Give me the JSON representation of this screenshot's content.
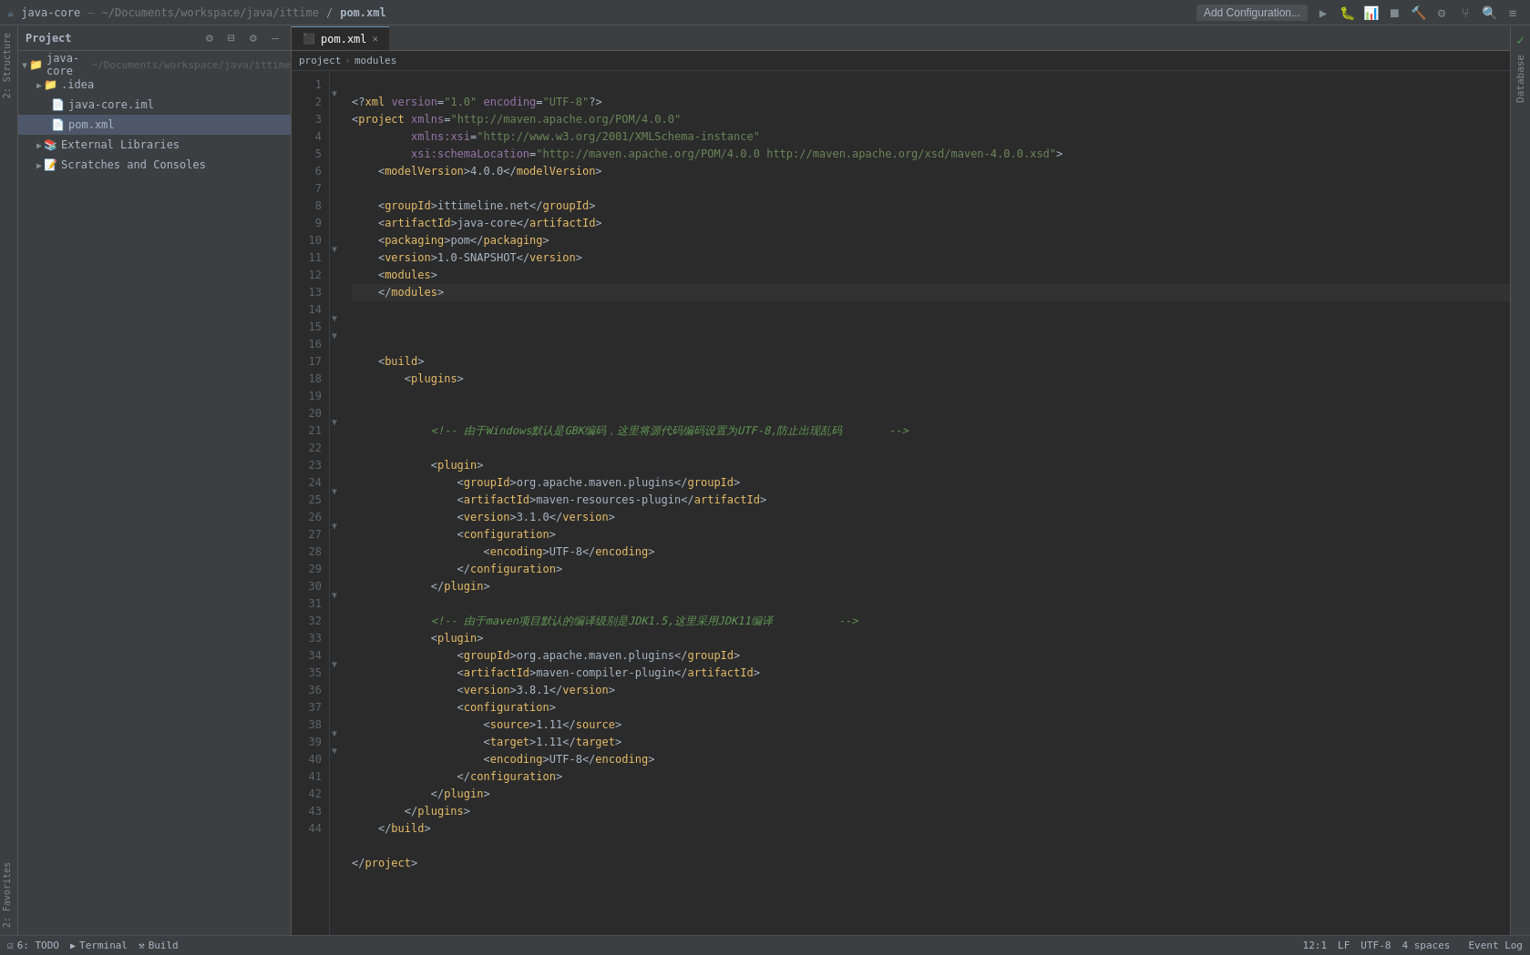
{
  "titleBar": {
    "projectLabel": "java-core",
    "pathLabel": "~/Documents/workspace/java/ittime",
    "fileLabel": "pom.xml",
    "addConfigLabel": "Add Configuration...",
    "separator": "▶"
  },
  "toolbar": {
    "icons": [
      "⚙",
      "⊟",
      "⚙",
      "–"
    ]
  },
  "projectPanel": {
    "title": "Project",
    "items": [
      {
        "label": "java-core",
        "type": "root",
        "indent": 0,
        "expanded": true
      },
      {
        "label": ".idea",
        "type": "folder",
        "indent": 1,
        "expanded": false
      },
      {
        "label": "java-core.iml",
        "type": "iml",
        "indent": 2,
        "expanded": false
      },
      {
        "label": "pom.xml",
        "type": "xml",
        "indent": 2,
        "expanded": false
      },
      {
        "label": "External Libraries",
        "type": "ext",
        "indent": 1,
        "expanded": false
      },
      {
        "label": "Scratches and Consoles",
        "type": "scratches",
        "indent": 1,
        "expanded": false
      }
    ]
  },
  "editorTabs": [
    {
      "label": "pom.xml",
      "active": true,
      "modified": false
    }
  ],
  "breadcrumb": {
    "items": [
      "project",
      "modules"
    ]
  },
  "codeLines": [
    {
      "num": 1,
      "content": "<?xml version=\"1.0\" encoding=\"UTF-8\"?>",
      "type": "xml-decl"
    },
    {
      "num": 2,
      "content": "<project xmlns=\"http://maven.apache.org/POM/4.0.0\"",
      "type": "xml"
    },
    {
      "num": 3,
      "content": "         xmlns:xsi=\"http://www.w3.org/2001/XMLSchema-instance\"",
      "type": "xml"
    },
    {
      "num": 4,
      "content": "         xsi:schemaLocation=\"http://maven.apache.org/POM/4.0.0 http://maven.apache.org/xsd/maven-4.0.0.xsd\">",
      "type": "xml"
    },
    {
      "num": 5,
      "content": "    <modelVersion>4.0.0</modelVersion>",
      "type": "xml"
    },
    {
      "num": 6,
      "content": "",
      "type": "empty"
    },
    {
      "num": 7,
      "content": "    <groupId>ittimeline.net</groupId>",
      "type": "xml"
    },
    {
      "num": 8,
      "content": "    <artifactId>java-core</artifactId>",
      "type": "xml"
    },
    {
      "num": 9,
      "content": "    <packaging>pom</packaging>",
      "type": "xml"
    },
    {
      "num": 10,
      "content": "    <version>1.0-SNAPSHOT</version>",
      "type": "xml"
    },
    {
      "num": 11,
      "content": "    <modules>",
      "type": "xml"
    },
    {
      "num": 12,
      "content": "    </modules>",
      "type": "xml",
      "current": true
    },
    {
      "num": 13,
      "content": "",
      "type": "empty"
    },
    {
      "num": 14,
      "content": "",
      "type": "empty"
    },
    {
      "num": 15,
      "content": "    <build>",
      "type": "xml"
    },
    {
      "num": 16,
      "content": "        <plugins>",
      "type": "xml"
    },
    {
      "num": 17,
      "content": "",
      "type": "empty"
    },
    {
      "num": 18,
      "content": "",
      "type": "empty"
    },
    {
      "num": 19,
      "content": "            <!-- 由于Windows默认是GBK编码，这里将源代码编码设置为UTF-8,防止出现乱码       -->",
      "type": "comment"
    },
    {
      "num": 20,
      "content": "",
      "type": "empty"
    },
    {
      "num": 21,
      "content": "            <plugin>",
      "type": "xml"
    },
    {
      "num": 22,
      "content": "                <groupId>org.apache.maven.plugins</groupId>",
      "type": "xml"
    },
    {
      "num": 23,
      "content": "                <artifactId>maven-resources-plugin</artifactId>",
      "type": "xml"
    },
    {
      "num": 24,
      "content": "                <version>3.1.0</version>",
      "type": "xml"
    },
    {
      "num": 25,
      "content": "                <configuration>",
      "type": "xml"
    },
    {
      "num": 26,
      "content": "                    <encoding>UTF-8</encoding>",
      "type": "xml"
    },
    {
      "num": 27,
      "content": "                </configuration>",
      "type": "xml"
    },
    {
      "num": 28,
      "content": "            </plugin>",
      "type": "xml"
    },
    {
      "num": 29,
      "content": "",
      "type": "empty"
    },
    {
      "num": 30,
      "content": "            <!-- 由于maven项目默认的编译级别是JDK1.5,这里采用JDK11编译          -->",
      "type": "comment"
    },
    {
      "num": 31,
      "content": "            <plugin>",
      "type": "xml"
    },
    {
      "num": 32,
      "content": "                <groupId>org.apache.maven.plugins</groupId>",
      "type": "xml"
    },
    {
      "num": 33,
      "content": "                <artifactId>maven-compiler-plugin</artifactId>",
      "type": "xml"
    },
    {
      "num": 34,
      "content": "                <version>3.8.1</version>",
      "type": "xml"
    },
    {
      "num": 35,
      "content": "                <configuration>",
      "type": "xml"
    },
    {
      "num": 36,
      "content": "                    <source>1.11</source>",
      "type": "xml"
    },
    {
      "num": 37,
      "content": "                    <target>1.11</target>",
      "type": "xml"
    },
    {
      "num": 38,
      "content": "                    <encoding>UTF-8</encoding>",
      "type": "xml"
    },
    {
      "num": 39,
      "content": "                </configuration>",
      "type": "xml"
    },
    {
      "num": 40,
      "content": "            </plugin>",
      "type": "xml"
    },
    {
      "num": 41,
      "content": "        </plugins>",
      "type": "xml"
    },
    {
      "num": 42,
      "content": "    </build>",
      "type": "xml"
    },
    {
      "num": 43,
      "content": "",
      "type": "empty"
    },
    {
      "num": 44,
      "content": "</project>",
      "type": "xml"
    }
  ],
  "statusBar": {
    "position": "12:1",
    "encoding": "UTF-8",
    "lineSep": "LF",
    "indent": "4 spaces"
  },
  "bottomTabs": [
    {
      "label": "6: TODO",
      "icon": "☑"
    },
    {
      "label": "Terminal",
      "icon": ">_"
    },
    {
      "label": "Build",
      "icon": "⚒"
    }
  ],
  "rightSidebar": {
    "label": "Database"
  },
  "leftVertTabs": [
    {
      "label": "2: Structure"
    },
    {
      "label": "2: Favorites"
    }
  ]
}
